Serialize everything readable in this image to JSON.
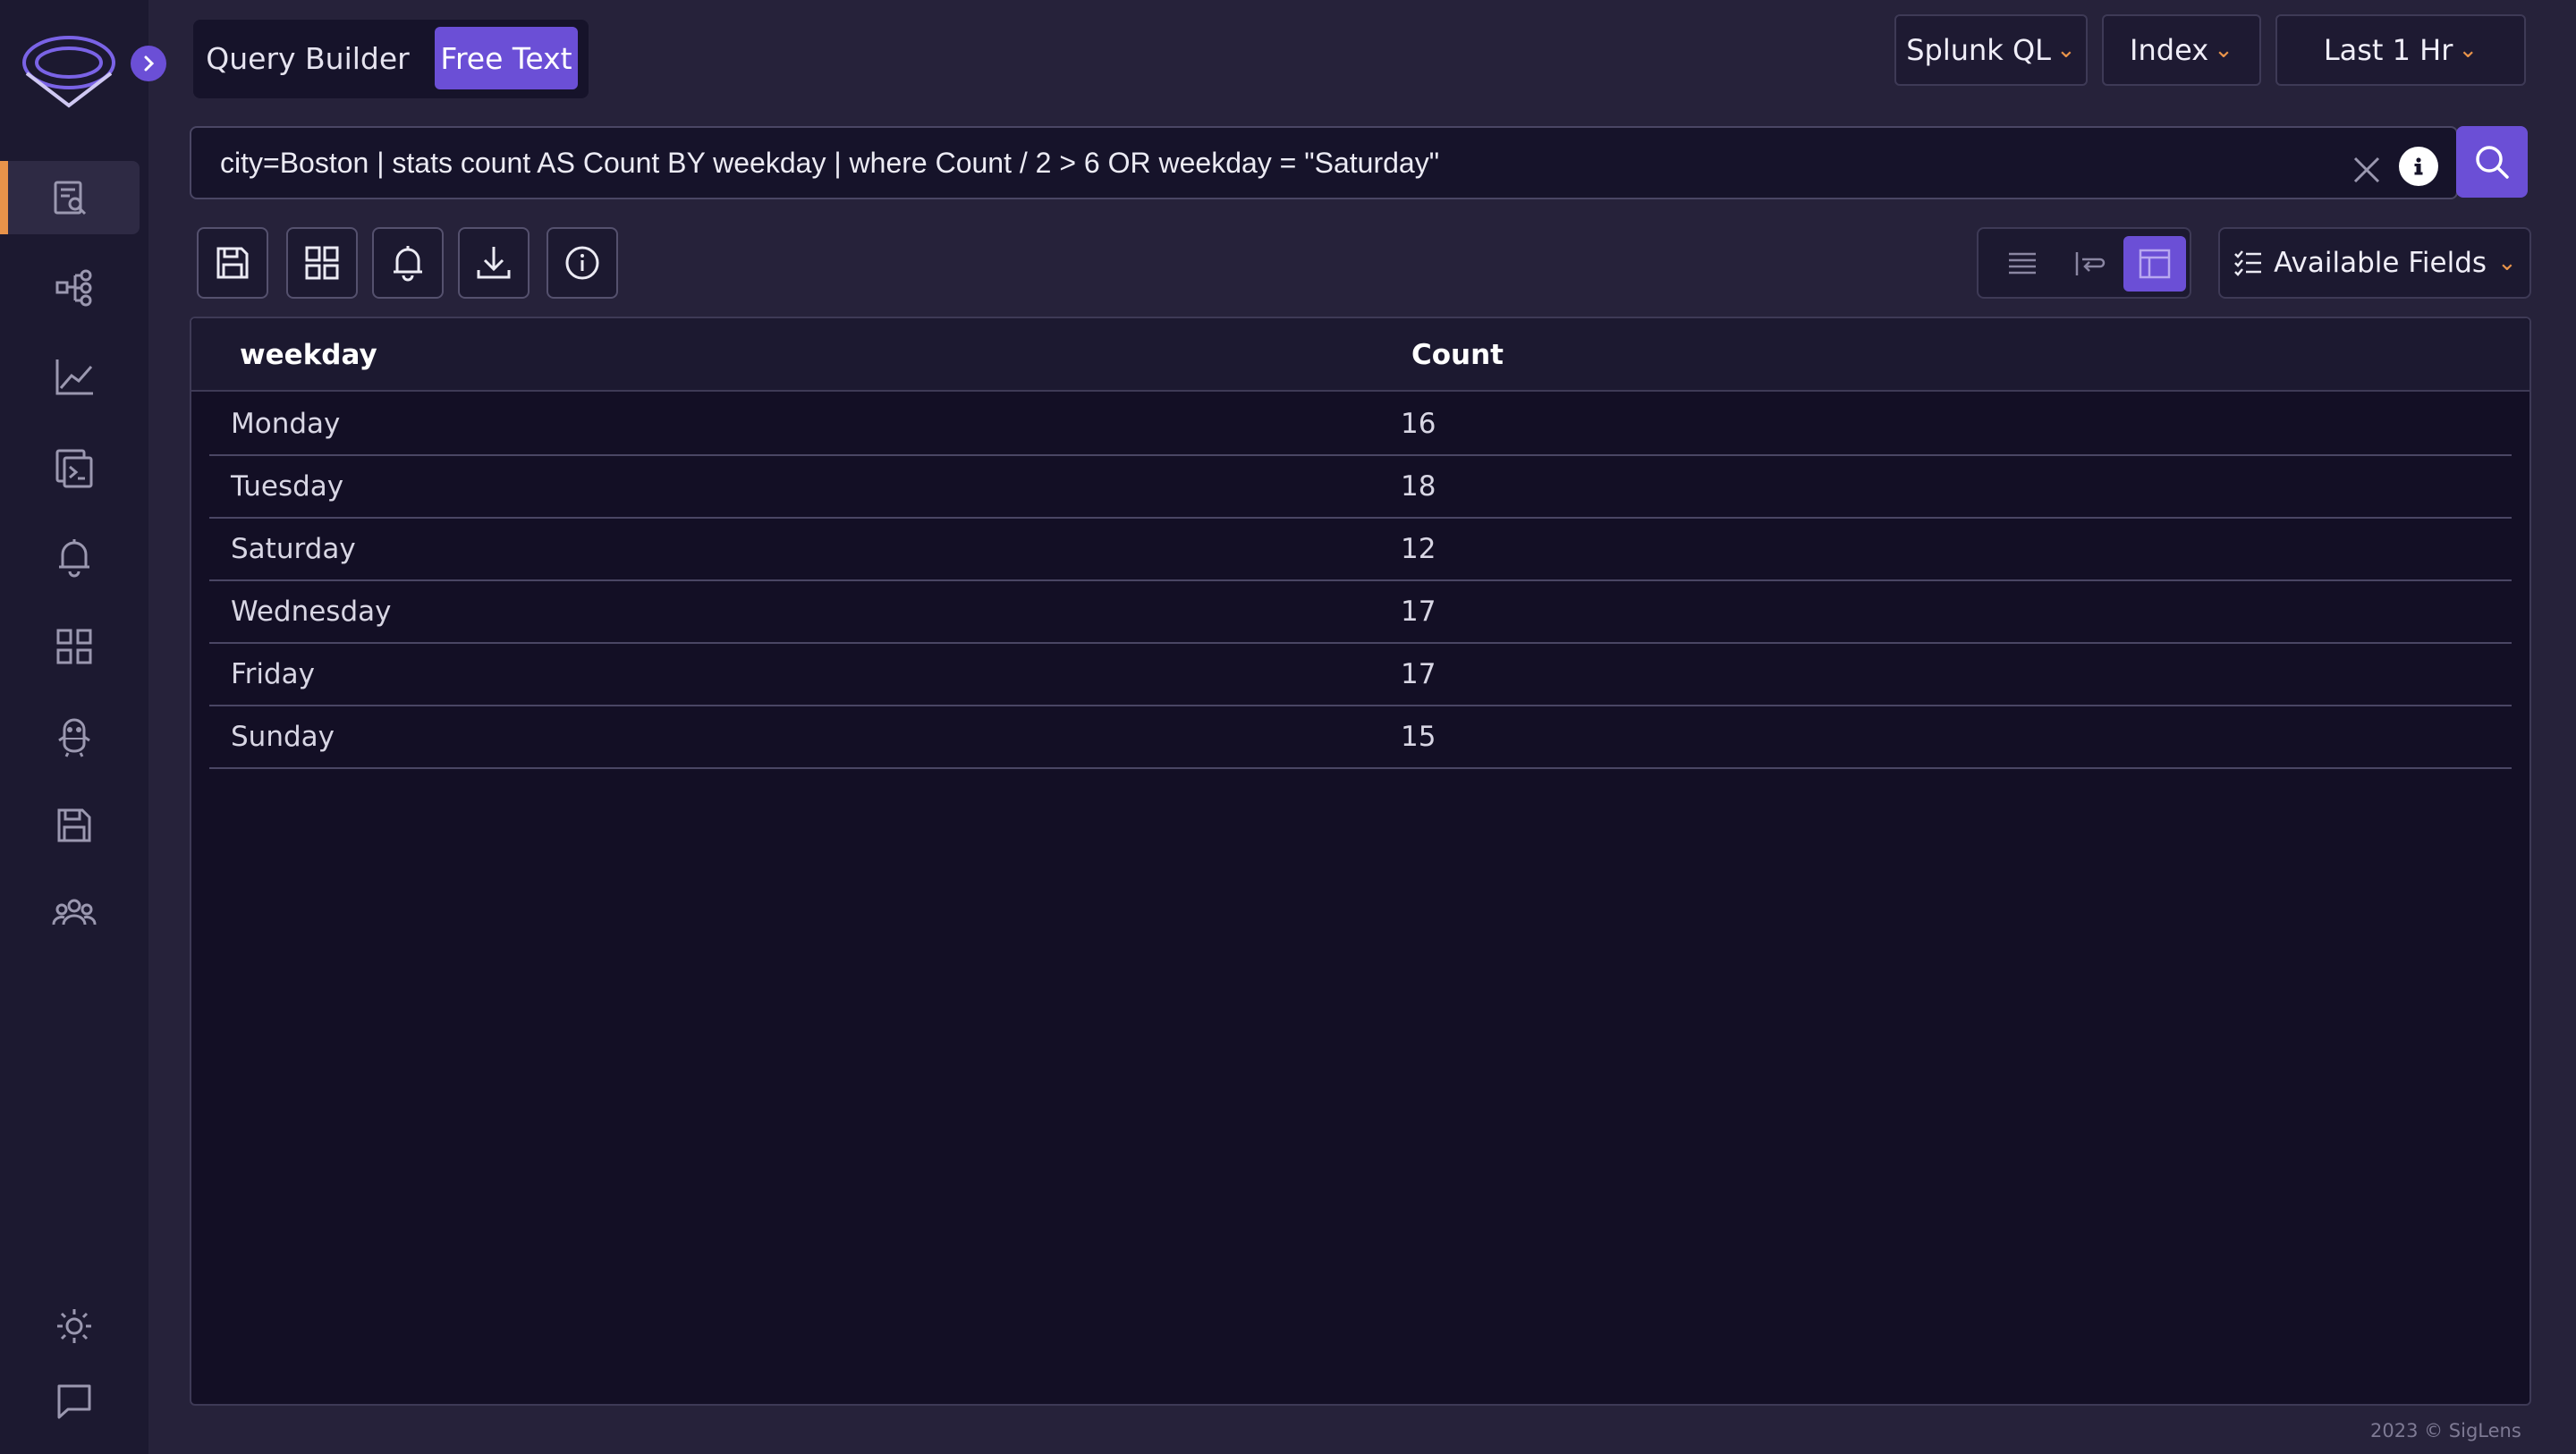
{
  "mode_toggle": {
    "query_builder": "Query Builder",
    "free_text": "Free Text"
  },
  "top_controls": {
    "query_language": "Splunk QL",
    "index": "Index",
    "time_range": "Last 1 Hr"
  },
  "search": {
    "query": "city=Boston | stats count AS Count BY weekday | where Count / 2 > 6 OR weekday = \"Saturday\""
  },
  "toolbar": {
    "icons": [
      "save-icon",
      "dashboard-grid-icon",
      "alert-bell-icon",
      "download-icon",
      "info-icon"
    ],
    "view_icons": [
      "list-view-icon",
      "wrap-view-icon",
      "table-view-icon"
    ],
    "available_fields": "Available Fields"
  },
  "results": {
    "columns": [
      "weekday",
      "Count"
    ],
    "rows": [
      {
        "weekday": "Monday",
        "count": "16"
      },
      {
        "weekday": "Tuesday",
        "count": "18"
      },
      {
        "weekday": "Saturday",
        "count": "12"
      },
      {
        "weekday": "Wednesday",
        "count": "17"
      },
      {
        "weekday": "Friday",
        "count": "17"
      },
      {
        "weekday": "Sunday",
        "count": "15"
      }
    ]
  },
  "sidebar": {
    "items": [
      "search-icon",
      "service-graph-icon",
      "metrics-icon",
      "live-tail-icon",
      "alerts-icon",
      "dashboards-icon",
      "ingestion-icon",
      "saved-queries-icon",
      "org-users-icon"
    ],
    "bottom": [
      "theme-icon",
      "feedback-icon"
    ]
  },
  "colors": {
    "accent": "#6b4fd6",
    "active_marker": "#e8934a",
    "background": "#26223a",
    "panel": "#130f25"
  },
  "footer": "2023 © SigLens"
}
